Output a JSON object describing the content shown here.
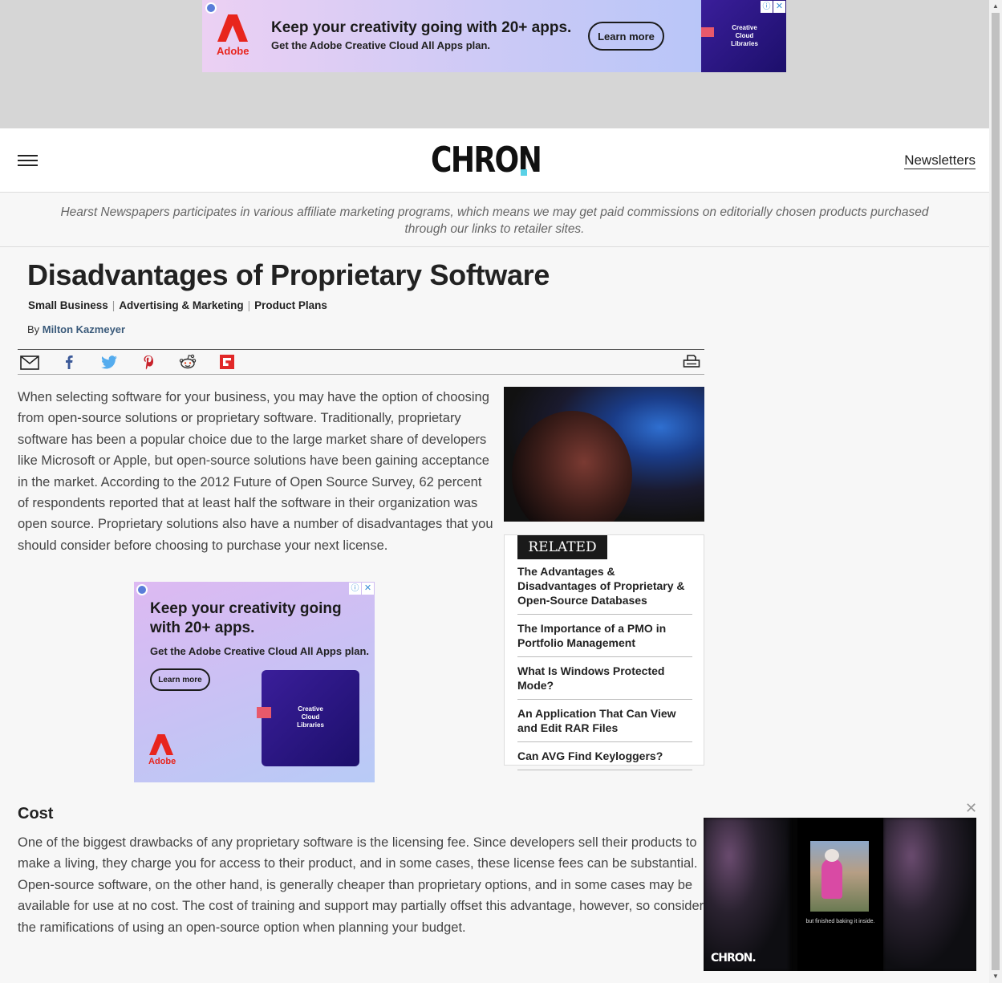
{
  "top_ad": {
    "headline": "Keep your creativity going with 20+ apps.",
    "subline": "Get the Adobe Creative Cloud All Apps plan.",
    "cta": "Learn more",
    "brand": "Adobe",
    "panel_text": "Creative Cloud Libraries"
  },
  "header": {
    "logo": "CHRON",
    "newsletters": "Newsletters"
  },
  "affiliate_notice": "Hearst Newspapers participates in various affiliate marketing programs, which means we may get paid commissions on editorially chosen products purchased through our links to retailer sites.",
  "article": {
    "title": "Disadvantages of Proprietary Software",
    "categories": [
      "Small Business",
      "Advertising & Marketing",
      "Product Plans"
    ],
    "by_label": "By",
    "author": "Milton Kazmeyer",
    "intro": "When selecting software for your business, you may have the option of choosing from open-source solutions or proprietary software. Traditionally, proprietary software has been a popular choice due to the large market share of developers like Microsoft or Apple, but open-source solutions have been gaining acceptance in the market. According to the 2012 Future of Open Source Survey, 62 percent of respondents reported that at least half the software in their organization was open source. Proprietary solutions also have a number of disadvantages that you should consider before choosing to purchase your next license.",
    "section_heading": "Cost",
    "section_body": "One of the biggest drawbacks of any proprietary software is the licensing fee. Since developers sell their products to make a living, they charge you for access to their product, and in some cases, these license fees can be substantial. Open-source software, on the other hand, is generally cheaper than proprietary options, and in some cases may be available for use at no cost. The cost of training and support may partially offset this advantage, however, so consider the ramifications of using an open-source option when planning your budget."
  },
  "share_icons": [
    "email-icon",
    "facebook-icon",
    "twitter-icon",
    "pinterest-icon",
    "reddit-icon",
    "flipboard-icon",
    "print-icon"
  ],
  "related": {
    "label": "RELATED",
    "items": [
      "The Advantages & Disadvantages of Proprietary & Open-Source Databases",
      "The Importance of a PMO in Portfolio Management",
      "What Is Windows Protected Mode?",
      "An Application That Can View and Edit RAR Files",
      "Can AVG Find Keyloggers?"
    ]
  },
  "mid_ad": {
    "headline": "Keep your creativity going with 20+ apps.",
    "subline": "Get the Adobe Creative Cloud All Apps plan.",
    "cta": "Learn more",
    "brand": "Adobe",
    "panel_text": "Creative Cloud Libraries"
  },
  "video": {
    "caption": "but finished baking it inside.",
    "logo": "CHRON."
  },
  "colors": {
    "accent": "#5ad1e6",
    "adobe_red": "#e8251d",
    "author_link": "#3a5a7a"
  }
}
